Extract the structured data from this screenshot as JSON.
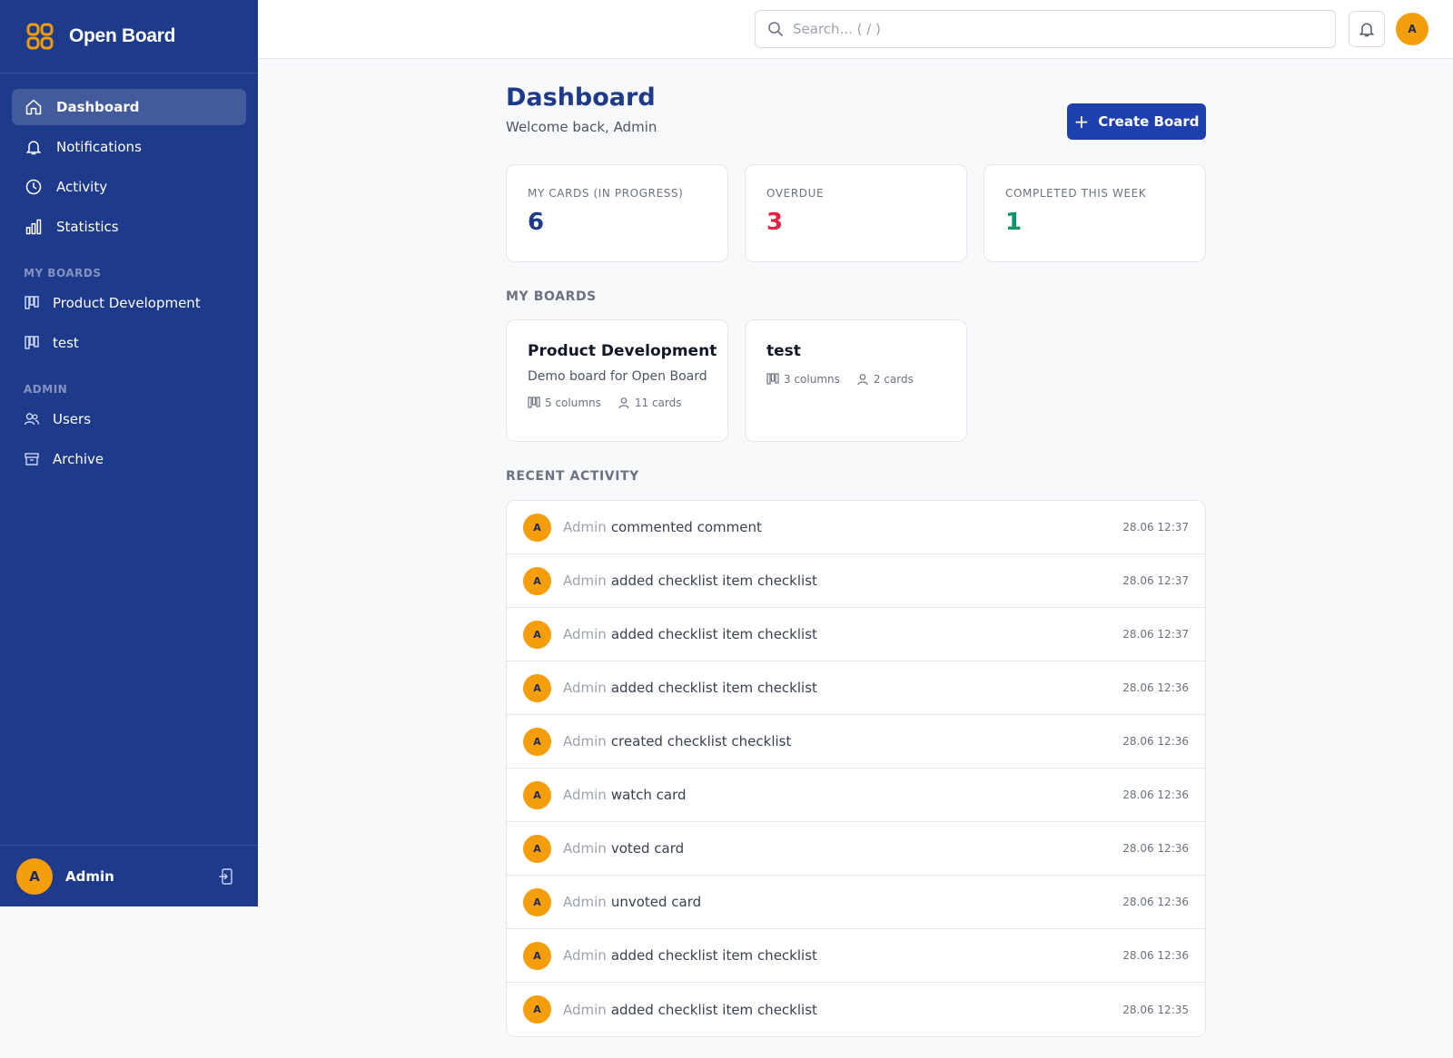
{
  "app": {
    "name": "Open Board"
  },
  "sidebar": {
    "nav": [
      {
        "label": "Dashboard",
        "icon": "home-icon",
        "active": true
      },
      {
        "label": "Notifications",
        "icon": "bell-icon"
      },
      {
        "label": "Activity",
        "icon": "clock-icon"
      },
      {
        "label": "Statistics",
        "icon": "bar-chart-icon"
      }
    ],
    "boards_label": "MY BOARDS",
    "boards": [
      {
        "label": "Product Development",
        "icon": "board-icon"
      },
      {
        "label": "test",
        "icon": "board-icon"
      }
    ],
    "admin_label": "ADMIN",
    "admin": [
      {
        "label": "Users",
        "icon": "users-icon"
      },
      {
        "label": "Archive",
        "icon": "archive-icon"
      }
    ],
    "user": {
      "initial": "A",
      "name": "Admin"
    }
  },
  "topbar": {
    "search_placeholder": "Search... ( / )",
    "avatar_initial": "A"
  },
  "page": {
    "title": "Dashboard",
    "welcome": "Welcome back, Admin",
    "create_label": "Create Board"
  },
  "stats": [
    {
      "label": "MY CARDS (IN PROGRESS)",
      "value": "6",
      "color": "#1e3a8a"
    },
    {
      "label": "OVERDUE",
      "value": "3",
      "color": "#dc2646"
    },
    {
      "label": "COMPLETED THIS WEEK",
      "value": "1",
      "color": "#059669"
    }
  ],
  "my_boards": {
    "heading": "MY BOARDS",
    "items": [
      {
        "title": "Product Development",
        "desc": "Demo board for Open Board",
        "columns": "5 columns",
        "cards": "11 cards"
      },
      {
        "title": "test",
        "desc": "",
        "columns": "3 columns",
        "cards": "2 cards"
      }
    ]
  },
  "recent_activity": {
    "heading": "RECENT ACTIVITY",
    "items": [
      {
        "initial": "A",
        "user": "Admin",
        "text": "commented comment",
        "time": "28.06 12:37"
      },
      {
        "initial": "A",
        "user": "Admin",
        "text": "added checklist item checklist",
        "time": "28.06 12:37"
      },
      {
        "initial": "A",
        "user": "Admin",
        "text": "added checklist item checklist",
        "time": "28.06 12:37"
      },
      {
        "initial": "A",
        "user": "Admin",
        "text": "added checklist item checklist",
        "time": "28.06 12:36"
      },
      {
        "initial": "A",
        "user": "Admin",
        "text": "created checklist checklist",
        "time": "28.06 12:36"
      },
      {
        "initial": "A",
        "user": "Admin",
        "text": "watch card",
        "time": "28.06 12:36"
      },
      {
        "initial": "A",
        "user": "Admin",
        "text": "voted card",
        "time": "28.06 12:36"
      },
      {
        "initial": "A",
        "user": "Admin",
        "text": "unvoted card",
        "time": "28.06 12:36"
      },
      {
        "initial": "A",
        "user": "Admin",
        "text": "added checklist item checklist",
        "time": "28.06 12:36"
      },
      {
        "initial": "A",
        "user": "Admin",
        "text": "added checklist item checklist",
        "time": "28.06 12:35"
      }
    ]
  },
  "colors": {
    "sidebar": "#1e3a8a",
    "accent": "#1e40af",
    "avatar": "#f59e0b",
    "logo": "#f59e0b"
  }
}
